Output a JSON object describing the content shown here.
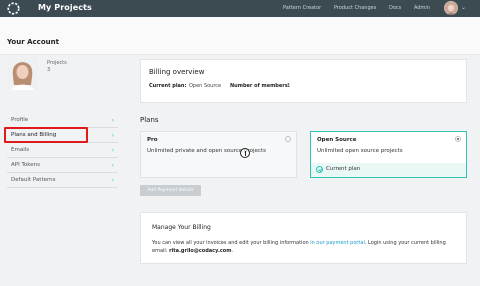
{
  "topbar": {
    "title": "My Projects",
    "nav": [
      "Pattern Creator",
      "Product Changes",
      "Docs",
      "Admin"
    ]
  },
  "page": {
    "heading": "Your Account"
  },
  "profile": {
    "projects_label": "Projects",
    "projects_count": "3"
  },
  "sidebar": {
    "items": [
      {
        "label": "Profile"
      },
      {
        "label": "Plans and Billing"
      },
      {
        "label": "Emails"
      },
      {
        "label": "API Tokens"
      },
      {
        "label": "Default Patterns"
      }
    ],
    "active_index": 1,
    "arrow_glyph": "›"
  },
  "billing_overview": {
    "title": "Billing overview",
    "plan_label": "Current plan:",
    "plan_value": "Open Source",
    "members_label": "Number of members:",
    "members_value": "1"
  },
  "plans": {
    "heading": "Plans",
    "cards": [
      {
        "name": "Pro",
        "description": "Unlimited private and open source projects",
        "selected": false
      },
      {
        "name": "Open Source",
        "description": "Unlimited open source projects",
        "selected": true
      }
    ],
    "current_plan_label": "Current plan",
    "add_payment_label": "Add Payment details"
  },
  "manage_billing": {
    "title": "Manage Your Billing",
    "text_before": "You can view all your invoices and edit your billing information ",
    "link": "in our payment portal",
    "text_after": ". Login using your current billing email: ",
    "email": "rita.grilo@codacy.com",
    "text_end": "."
  },
  "colors": {
    "topbar": "#3c4a52",
    "accent": "#2ec4b6",
    "link": "#1a9bc7",
    "highlight": "#e0191b"
  },
  "icons": {
    "logo": "codacy-logo-icon",
    "caret": "chevron-down-icon",
    "check": "check-circle-icon",
    "cursor": "text-cursor-icon"
  }
}
